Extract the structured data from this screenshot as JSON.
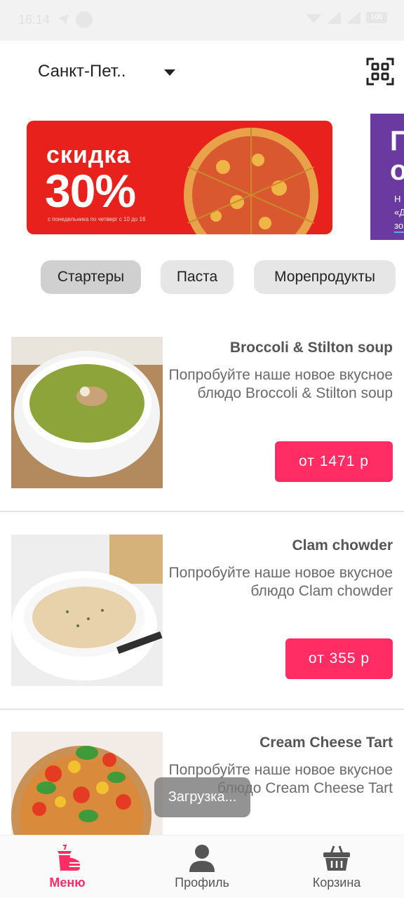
{
  "status_bar": {
    "time": "16:14",
    "battery": "100"
  },
  "header": {
    "city": "Санкт-Пет..",
    "qr_icon": "qr-code-icon"
  },
  "banners": [
    {
      "title": "скидка",
      "percent": "30%",
      "subtitle": "с понедельника по четверг с 10 до 16",
      "colors": {
        "bg": "#e8211d",
        "text": "#ffffff"
      }
    },
    {
      "big": "П\nо",
      "small": "Н\n«Д\nзо",
      "colors": {
        "bg": "#6a3aa0",
        "text": "#ffffff"
      }
    }
  ],
  "tabs": [
    {
      "label": "Стартеры",
      "active": true
    },
    {
      "label": "Паста",
      "active": false
    },
    {
      "label": "Морепродукты",
      "active": false
    }
  ],
  "products": [
    {
      "name": "Broccoli & Stilton soup",
      "description": "Попробуйте наше новое вкусное блюдо Broccoli & Stilton soup",
      "price": "от 1471 р"
    },
    {
      "name": "Clam chowder",
      "description": "Попробуйте наше новое вкусное блюдо Clam chowder",
      "price": "от 355 р"
    },
    {
      "name": "Cream Cheese Tart",
      "description": "Попробуйте наше новое вкусное блюдо Cream Cheese Tart",
      "price": ""
    }
  ],
  "toast": "Загрузка...",
  "bottom_nav": [
    {
      "label": "Меню",
      "icon": "burger-drink-icon",
      "active": true
    },
    {
      "label": "Профиль",
      "icon": "person-icon",
      "active": false
    },
    {
      "label": "Корзина",
      "icon": "basket-icon",
      "active": false
    }
  ],
  "colors": {
    "accent": "#ff2d64",
    "tab_bg": "#e6e6e6",
    "tab_active_bg": "#d0d0d0"
  }
}
